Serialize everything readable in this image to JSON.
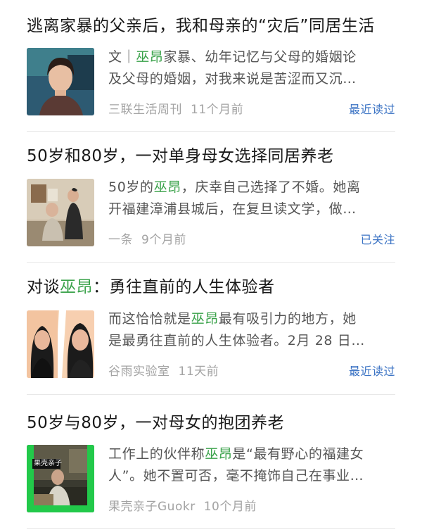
{
  "results": [
    {
      "title_parts": [
        "逃离家暴的父亲后，我和母亲的“灾后”同居生活"
      ],
      "snippet_line1": [
        "文｜",
        "巫昂",
        "家暴、幼年记忆与父母的婚姻论"
      ],
      "snippet_line2": "及父母的婚姻，对我来说是苦涩而又沉…",
      "source": "三联生活周刊",
      "time": "11个月前",
      "badge": "最近读过",
      "thumb_icon": "portrait-photo-icon",
      "colors": {
        "thumb_bg": "#2d5a72"
      }
    },
    {
      "title_parts": [
        "50岁和80岁，一对单身母女选择同居养老"
      ],
      "snippet_line1": [
        "50岁的",
        "巫昂",
        "，庆幸自己选择了不婚。她离"
      ],
      "snippet_line2": "开福建漳浦县城后，在复旦读文学，做…",
      "source": "一条",
      "time": "9个月前",
      "badge": "已关注",
      "thumb_icon": "mother-daughter-photo-icon",
      "colors": {
        "thumb_bg": "#b9a58d"
      }
    },
    {
      "title_parts": [
        "对谈",
        "巫昂",
        "：勇往直前的人生体验者"
      ],
      "snippet_line1": [
        "而这恰恰就是",
        "巫昂",
        "最有吸引力的地方，她"
      ],
      "snippet_line2": "是最勇往直前的人生体验者。2月 28 日…",
      "source": "谷雨实验室",
      "time": "11天前",
      "badge": "最近读过",
      "thumb_icon": "two-portraits-icon",
      "colors": {
        "thumb_bg": "#f3c7a0"
      }
    },
    {
      "title_parts": [
        "50岁与80岁，一对母女的抱团养老"
      ],
      "snippet_line1": [
        "工作上的伙伴称",
        "巫昂",
        "是“最有野心的福建女"
      ],
      "snippet_line2": "人”。她不置可否，毫不掩饰自己在事业…",
      "source": "果壳亲子Guokr",
      "time": "10个月前",
      "badge": "",
      "thumb_label": "果壳亲子",
      "thumb_icon": "guokr-video-photo-icon",
      "colors": {
        "thumb_bg": "#2a2a24",
        "accent": "#28e04e"
      }
    }
  ],
  "colors": {
    "highlight": "#3aa24a",
    "link": "#3b73c4",
    "meta": "#a3a3a3"
  }
}
